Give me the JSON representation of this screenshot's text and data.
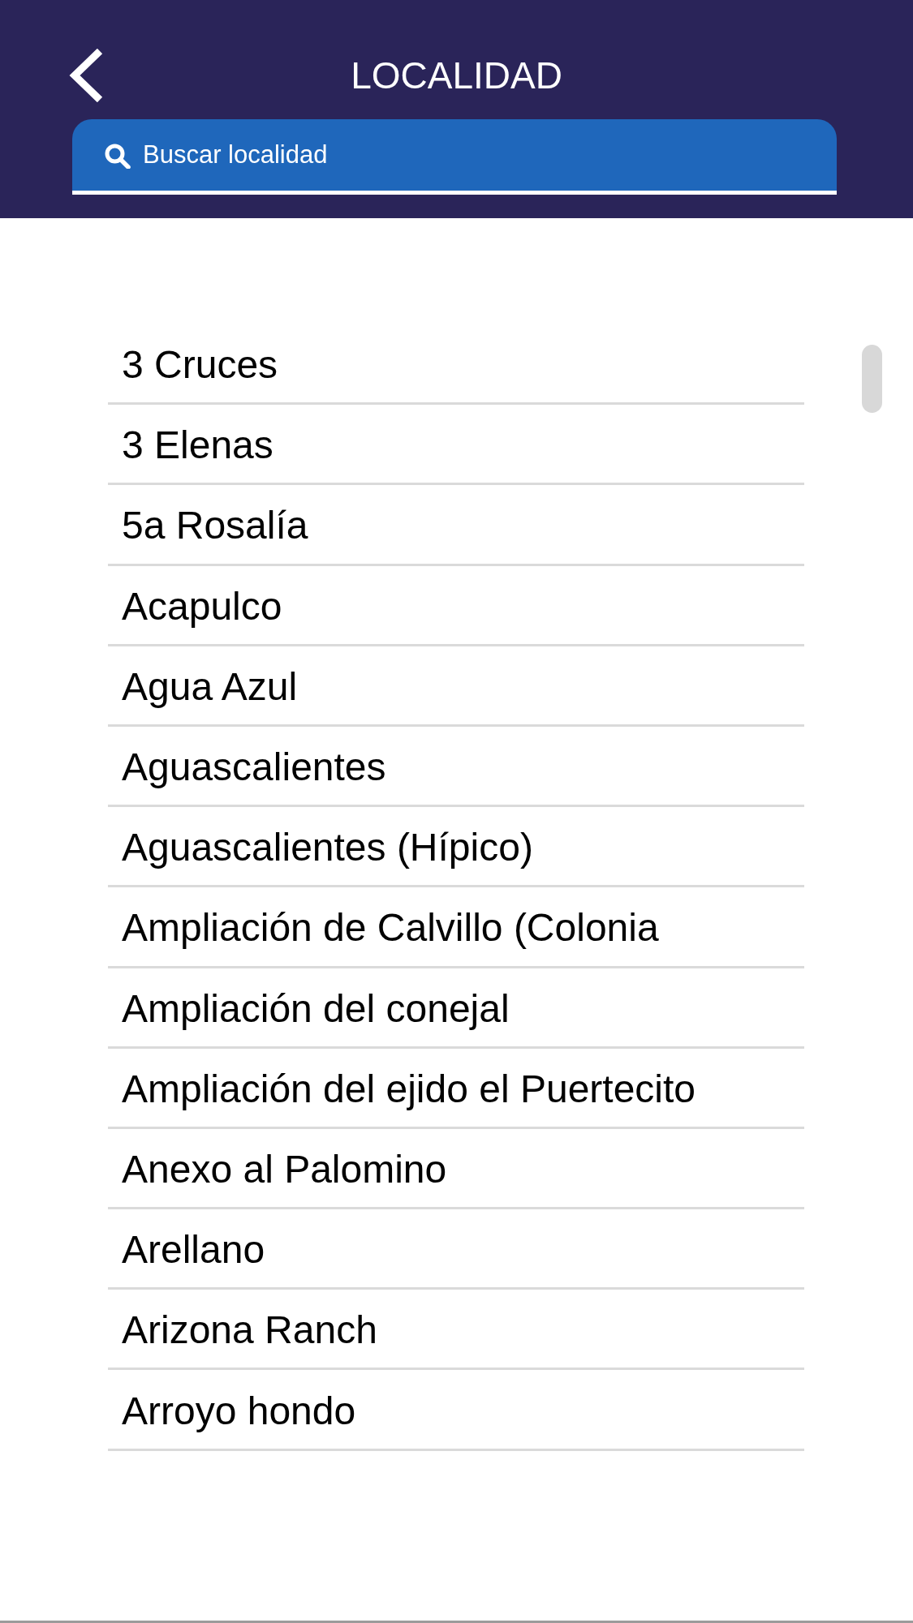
{
  "header": {
    "title": "LOCALIDAD"
  },
  "search": {
    "placeholder": "Buscar localidad"
  },
  "localities": [
    "3 Cruces",
    "3 Elenas",
    "5a Rosalía",
    "Acapulco",
    "Agua Azul",
    "Aguascalientes",
    "Aguascalientes (Hípico)",
    "Ampliación de Calvillo (Colonia",
    "Ampliación del conejal",
    "Ampliación del ejido el Puertecito",
    "Anexo al Palomino",
    "Arellano",
    "Arizona Ranch",
    "Arroyo hondo"
  ]
}
